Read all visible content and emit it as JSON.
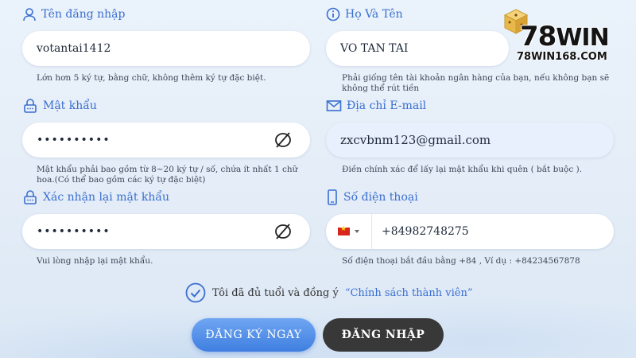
{
  "logo": {
    "brand_main": "78",
    "brand_win": "WIN",
    "url": "78WIN168.COM"
  },
  "fields": {
    "username": {
      "label": "Tên đăng nhập",
      "value": "votantai1412",
      "hint": "Lớn hơn 5 ký tự, bằng chữ, không thêm ký tự đặc biệt."
    },
    "fullname": {
      "label": "Họ Và Tên",
      "value": "VO TAN TAI",
      "hint": "Phải giống tên tài khoản ngân hàng của bạn, nếu không bạn sẽ không thể rút tiền"
    },
    "password": {
      "label": "Mật khẩu",
      "value": "••••••••••",
      "hint": "Mật khẩu phải bao gồm từ 8~20 ký tự / số, chứa ít nhất 1 chữ hoa.(Có thể bao gồm các ký tự đặc biệt)"
    },
    "email": {
      "label": "Địa chỉ E-mail",
      "value": "zxcvbnm123@gmail.com",
      "hint": "Điền chính xác để lấy lại mật khẩu khi quên ( bắt buộc )."
    },
    "confirm": {
      "label": "Xác nhận lại mật khẩu",
      "value": "••••••••••",
      "hint": "Vui lòng nhập lại mật khẩu."
    },
    "phone": {
      "label": "Số điện thoại",
      "value": "+84982748275",
      "hint": "Số điện thoại bắt đầu bằng +84 , Ví dụ : +84234567878"
    }
  },
  "agree": {
    "text": "Tôi đã đủ tuổi và đồng ý",
    "link": "“Chính sách thành viên”"
  },
  "buttons": {
    "register": "ĐĂNG KÝ NGAY",
    "login": "ĐĂNG NHẬP"
  },
  "colors": {
    "accent": "#3a6fd0",
    "register_bg": "#4f8ee8",
    "login_bg": "#383838"
  }
}
